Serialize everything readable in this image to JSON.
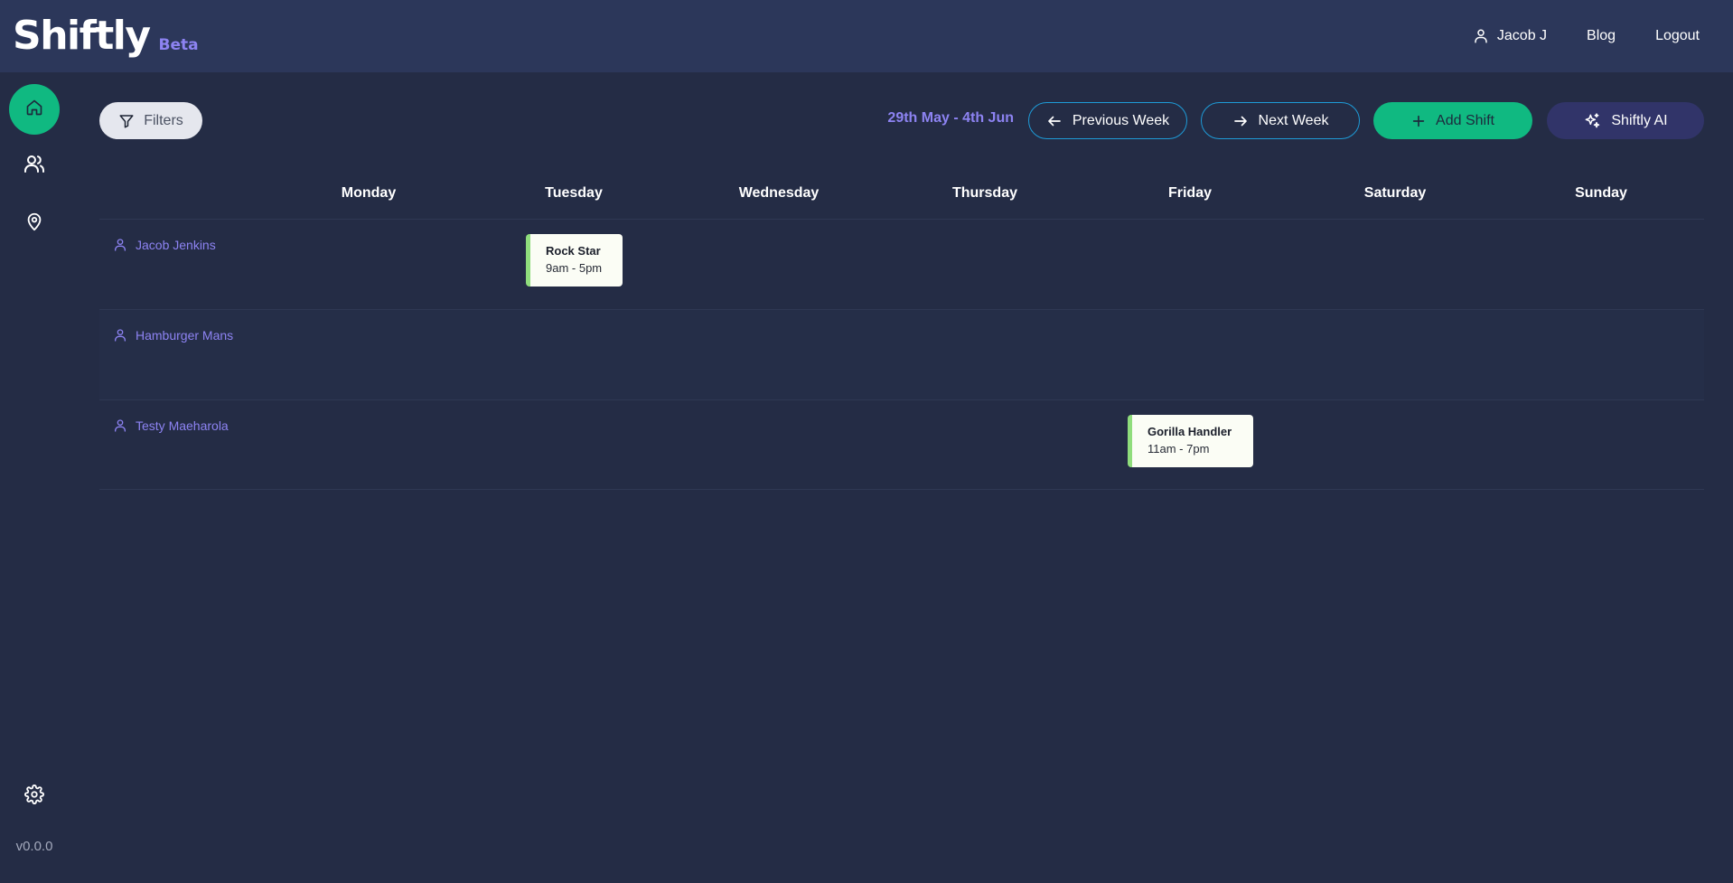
{
  "header": {
    "brand": "Shiftly",
    "badge": "Beta",
    "user_label": "Jacob J",
    "blog_label": "Blog",
    "logout_label": "Logout"
  },
  "sidebar": {
    "items": [
      {
        "name": "home",
        "icon": "home-icon",
        "active": true
      },
      {
        "name": "people",
        "icon": "users-icon",
        "active": false
      },
      {
        "name": "locations",
        "icon": "map-pin-icon",
        "active": false
      }
    ],
    "settings_icon": "gear-icon",
    "version": "v0.0.0"
  },
  "toolbar": {
    "filters_label": "Filters",
    "date_range": "29th May - 4th Jun",
    "prev_label": "Previous Week",
    "next_label": "Next Week",
    "add_label": "Add Shift",
    "ai_label": "Shiftly AI"
  },
  "calendar": {
    "days": [
      "Monday",
      "Tuesday",
      "Wednesday",
      "Thursday",
      "Friday",
      "Saturday",
      "Sunday"
    ],
    "employees": [
      {
        "name": "Jacob Jenkins",
        "shifts": [
          {
            "day": "Tuesday",
            "role": "Rock Star",
            "time": "9am - 5pm"
          }
        ]
      },
      {
        "name": "Hamburger Mans",
        "shifts": []
      },
      {
        "name": "Testy Maeharola",
        "shifts": [
          {
            "day": "Friday",
            "role": "Gorilla Handler",
            "time": "11am - 7pm"
          }
        ]
      }
    ]
  },
  "colors": {
    "background": "#242c45",
    "header": "#2c375a",
    "accent_green": "#10b981",
    "accent_purple": "#8d83f2",
    "outline_blue": "#1e9bd7",
    "shift_bar": "#8fdd7c"
  }
}
